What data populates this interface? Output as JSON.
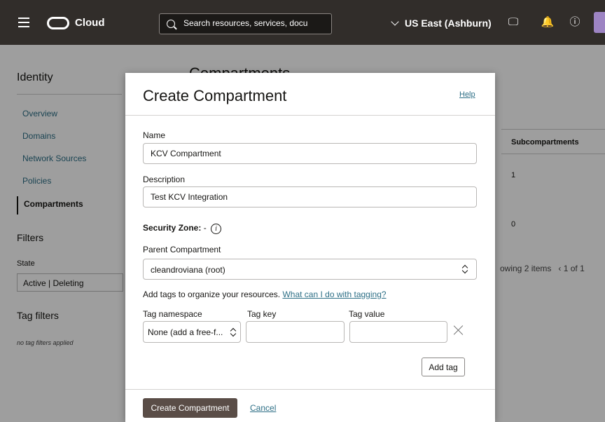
{
  "topbar": {
    "brand": "Cloud",
    "search_placeholder": "Search resources, services, docu",
    "region": "US East (Ashburn)"
  },
  "background": {
    "sidebar_title": "Identity",
    "nav": [
      "Overview",
      "Domains",
      "Network Sources",
      "Policies",
      "Compartments"
    ],
    "filters_title": "Filters",
    "state_label": "State",
    "state_value": "Active | Deleting",
    "tag_filters_title": "Tag filters",
    "tag_filters_note": "no tag filters applied",
    "page_title": "Compartments",
    "column_header": "Subcompartments",
    "cells": [
      "1",
      "0"
    ],
    "pagination": "owing 2 items",
    "page_indicator": "1 of 1"
  },
  "modal": {
    "title": "Create Compartment",
    "help_link": "Help",
    "name_label": "Name",
    "name_value": "KCV Compartment",
    "description_label": "Description",
    "description_value": "Test KCV Integration",
    "security_zone_label": "Security Zone:",
    "security_zone_value": "-",
    "info_glyph": "i",
    "parent_label": "Parent Compartment",
    "parent_value": "cleandroviana (root)",
    "tags_text": "Add tags to organize your resources.",
    "tags_link": "What can I do with tagging?",
    "tag_namespace_label": "Tag namespace",
    "tag_key_label": "Tag key",
    "tag_value_label": "Tag value",
    "tag_namespace_value": "None (add a free-f...",
    "tag_key_value": "",
    "tag_value_value": "",
    "add_tag_button": "Add tag",
    "create_button": "Create Compartment",
    "cancel_link": "Cancel"
  }
}
